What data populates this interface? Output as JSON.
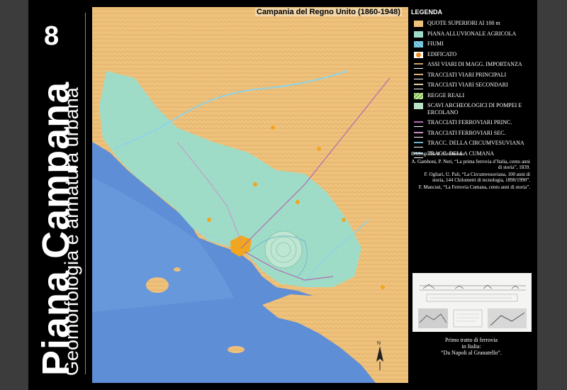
{
  "board": {
    "number": "8",
    "title": "Piana Campana",
    "subtitle": "Geomorfologia e armatura urbana"
  },
  "map": {
    "title": "Campania del Regno Unito (1860-1948)",
    "north_label": "N",
    "colors": {
      "sea": "#5e8ed6",
      "plain": "#9fdcc7",
      "hills": "#efc27c",
      "river": "#8fd3e8",
      "built": "#f2a51e"
    }
  },
  "legend": {
    "title": "LEGENDA",
    "items": [
      {
        "label": "QUOTE SUPERIORI AI 100 m",
        "color": "#efc27c",
        "style": "fill"
      },
      {
        "label": "PIANA ALLUVIONALE AGRICOLA",
        "color": "#9fdcc7",
        "style": "fill"
      },
      {
        "label": "FIUMI",
        "color": "#8fd3e8",
        "style": "wave"
      },
      {
        "label": "EDIFICATO",
        "color": "#f28a1e",
        "style": "blob"
      },
      {
        "label": "ASSI VIARI DI MAGG. IMPORTANZA",
        "color": "#c9a063",
        "style": "line"
      },
      {
        "label": "TRACCIATI VIARI PRINCIPALI",
        "color": "#d8b27a",
        "style": "line"
      },
      {
        "label": "TRACCIATI VIARI SECONDARI",
        "color": "#e6cfa8",
        "style": "line"
      },
      {
        "label": "REGGE REALI",
        "color": "#7ab94e",
        "style": "hatch"
      },
      {
        "label": "SCAVI ARCHEOLOGICI DI POMPEI E ERCOLANO",
        "color": "#b7e3c5",
        "style": "fill"
      },
      {
        "label": "TRACCIATI FERROVIARI PRINC.",
        "color": "#b06ab0",
        "style": "line"
      },
      {
        "label": "TRACCIATI FERROVIARI SEC.",
        "color": "#c890c8",
        "style": "line"
      },
      {
        "label": "TRACC. DELLA CIRCUMVESUVIANA",
        "color": "#6fb8c9",
        "style": "line"
      },
      {
        "label": "TRACC. DELLA CUMANA",
        "color": "#9fd0e0",
        "style": "line"
      }
    ]
  },
  "bibliography": {
    "heading": "Bibliografia di riferimento:",
    "entries": [
      "A. Gamboni, P. Neri, “La prima ferrovia d’Italia, cento anni di storia”, 1839.",
      "F. Ogliari, U. Pali, “La Circumvesuviana, 100 anni di storia, 144 Chilometri di tecnologia, 1890/1990”.",
      "F. Mancusi, “La Ferrovia Cumana, cento anni di storia”."
    ]
  },
  "photo": {
    "caption": [
      "Primo tratto di ferrovia",
      "in Italia:",
      "“Da Napoli al Granatello”."
    ]
  }
}
